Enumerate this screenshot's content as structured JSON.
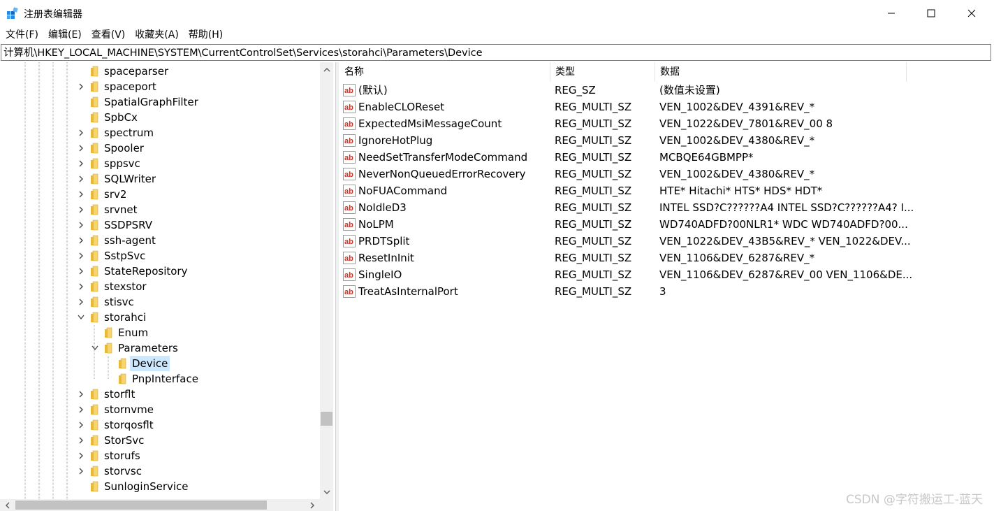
{
  "window": {
    "title": "注册表编辑器",
    "controls": {
      "minimize": "—",
      "maximize": "☐",
      "close": "✕"
    }
  },
  "menu": [
    "文件(F)",
    "编辑(E)",
    "查看(V)",
    "收藏夹(A)",
    "帮助(H)"
  ],
  "address": "计算机\\HKEY_LOCAL_MACHINE\\SYSTEM\\CurrentControlSet\\Services\\storahci\\Parameters\\Device",
  "tree": [
    {
      "label": "spaceparser",
      "expander": "none",
      "level": 0
    },
    {
      "label": "spaceport",
      "expander": "collapsed",
      "level": 0
    },
    {
      "label": "SpatialGraphFilter",
      "expander": "none",
      "level": 0
    },
    {
      "label": "SpbCx",
      "expander": "none",
      "level": 0
    },
    {
      "label": "spectrum",
      "expander": "collapsed",
      "level": 0
    },
    {
      "label": "Spooler",
      "expander": "collapsed",
      "level": 0
    },
    {
      "label": "sppsvc",
      "expander": "collapsed",
      "level": 0
    },
    {
      "label": "SQLWriter",
      "expander": "collapsed",
      "level": 0
    },
    {
      "label": "srv2",
      "expander": "collapsed",
      "level": 0
    },
    {
      "label": "srvnet",
      "expander": "collapsed",
      "level": 0
    },
    {
      "label": "SSDPSRV",
      "expander": "collapsed",
      "level": 0
    },
    {
      "label": "ssh-agent",
      "expander": "collapsed",
      "level": 0
    },
    {
      "label": "SstpSvc",
      "expander": "collapsed",
      "level": 0
    },
    {
      "label": "StateRepository",
      "expander": "collapsed",
      "level": 0
    },
    {
      "label": "stexstor",
      "expander": "collapsed",
      "level": 0
    },
    {
      "label": "stisvc",
      "expander": "collapsed",
      "level": 0
    },
    {
      "label": "storahci",
      "expander": "expanded",
      "level": 0
    },
    {
      "label": "Enum",
      "expander": "none",
      "level": 1
    },
    {
      "label": "Parameters",
      "expander": "expanded",
      "level": 1
    },
    {
      "label": "Device",
      "expander": "none",
      "level": 2,
      "selected": true
    },
    {
      "label": "PnpInterface",
      "expander": "none",
      "level": 2
    },
    {
      "label": "storflt",
      "expander": "collapsed",
      "level": 0
    },
    {
      "label": "stornvme",
      "expander": "collapsed",
      "level": 0
    },
    {
      "label": "storqosflt",
      "expander": "collapsed",
      "level": 0
    },
    {
      "label": "StorSvc",
      "expander": "collapsed",
      "level": 0
    },
    {
      "label": "storufs",
      "expander": "collapsed",
      "level": 0
    },
    {
      "label": "storvsc",
      "expander": "collapsed",
      "level": 0
    },
    {
      "label": "SunloginService",
      "expander": "none",
      "level": 0
    }
  ],
  "columns": {
    "name": "名称",
    "type": "类型",
    "data": "数据"
  },
  "values": [
    {
      "name": "(默认)",
      "type": "REG_SZ",
      "data": "(数值未设置)"
    },
    {
      "name": "EnableCLOReset",
      "type": "REG_MULTI_SZ",
      "data": "VEN_1002&DEV_4391&REV_*"
    },
    {
      "name": "ExpectedMsiMessageCount",
      "type": "REG_MULTI_SZ",
      "data": "VEN_1022&DEV_7801&REV_00 8"
    },
    {
      "name": "IgnoreHotPlug",
      "type": "REG_MULTI_SZ",
      "data": "VEN_1002&DEV_4380&REV_*"
    },
    {
      "name": "NeedSetTransferModeCommand",
      "type": "REG_MULTI_SZ",
      "data": "MCBQE64GBMPP*"
    },
    {
      "name": "NeverNonQueuedErrorRecovery",
      "type": "REG_MULTI_SZ",
      "data": "VEN_1002&DEV_4380&REV_*"
    },
    {
      "name": "NoFUACommand",
      "type": "REG_MULTI_SZ",
      "data": "HTE* Hitachi* HTS* HDS* HDT*"
    },
    {
      "name": "NoIdleD3",
      "type": "REG_MULTI_SZ",
      "data": "INTEL SSD?C??????A4 INTEL SSD?C??????A4? I..."
    },
    {
      "name": "NoLPM",
      "type": "REG_MULTI_SZ",
      "data": "WD740ADFD?00NLR1* WDC WD740ADFD?00..."
    },
    {
      "name": "PRDTSplit",
      "type": "REG_MULTI_SZ",
      "data": "VEN_1022&DEV_43B5&REV_* VEN_1022&DEV..."
    },
    {
      "name": "ResetInInit",
      "type": "REG_MULTI_SZ",
      "data": "VEN_1106&DEV_6287&REV_*"
    },
    {
      "name": "SingleIO",
      "type": "REG_MULTI_SZ",
      "data": "VEN_1106&DEV_6287&REV_00 VEN_1106&DE..."
    },
    {
      "name": "TreatAsInternalPort",
      "type": "REG_MULTI_SZ",
      "data": "3"
    }
  ],
  "value_icon_text": "ab",
  "watermark": "CSDN @字符搬运工-蓝天",
  "colors": {
    "selection": "#cce8ff",
    "folder": "#f7d56b",
    "ab_icon": "#c0392b"
  }
}
